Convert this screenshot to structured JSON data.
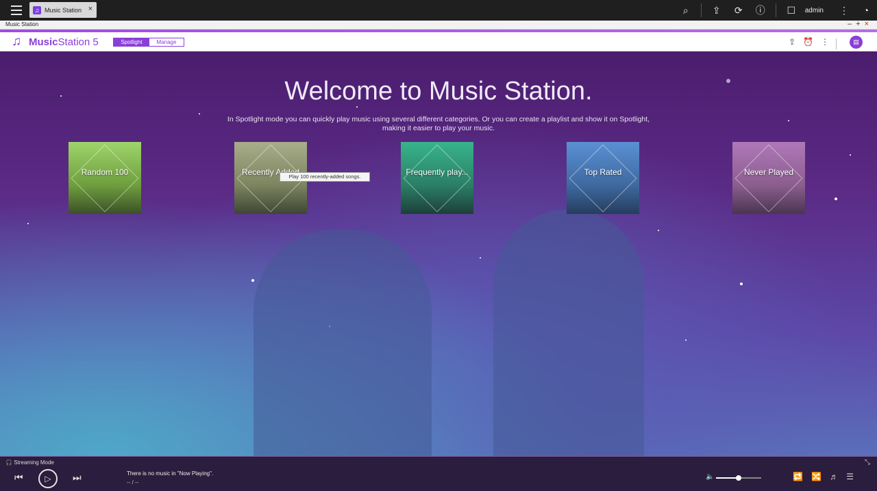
{
  "os_bar": {
    "tab_label": "Music Station",
    "user": "admin"
  },
  "window": {
    "title": "Music Station"
  },
  "app": {
    "logo_bold": "Music",
    "logo_rest": "Station 5",
    "mode_on": "Spotlight",
    "mode_off": "Manage"
  },
  "main": {
    "welcome": "Welcome to Music Station.",
    "subtext": "In Spotlight mode you can quickly play music using several different categories. Or you can create a playlist and show it on Spotlight, making it easier to play your music.",
    "tiles": [
      {
        "label": "Random 100"
      },
      {
        "label": "Recently Added"
      },
      {
        "label": "Frequently play..."
      },
      {
        "label": "Top Rated"
      },
      {
        "label": "Never Played"
      }
    ],
    "tooltip": "Play 100 recently-added songs."
  },
  "player": {
    "mode": "Streaming Mode",
    "now_playing": "There is no music in \"Now Playing\".",
    "time": "-- / --",
    "volume": 0.5
  },
  "colors": {
    "accent": "#8a3fd8"
  },
  "icons": [
    "menu-icon",
    "music-note-icon",
    "search-icon",
    "upload-icon",
    "sync-icon",
    "info-icon",
    "user-icon",
    "more-icon",
    "dashboard-icon",
    "alarm-icon",
    "chat-icon",
    "prev-icon",
    "play-icon",
    "next-icon",
    "volume-icon",
    "repeat-icon",
    "shuffle-icon",
    "lyrics-icon",
    "playlist-icon"
  ]
}
